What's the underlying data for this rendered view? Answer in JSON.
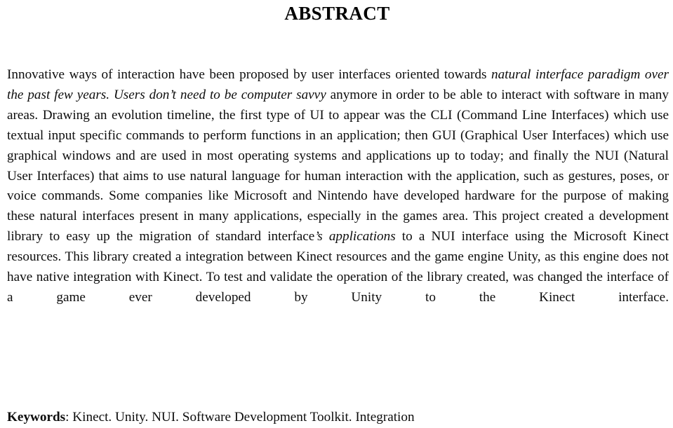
{
  "document": {
    "heading": "ABSTRACT",
    "abstract": {
      "segments": [
        {
          "style": "roman",
          "text": "Innovative ways of interaction have been proposed by user interfaces oriented towards "
        },
        {
          "style": "italic",
          "text": "natural interface paradigm over the past few years. Users don’t need to be computer savvy"
        },
        {
          "style": "roman",
          "text": " anymore in order to be able to interact with software in many areas. Drawing an evolution timeline, the first type of UI to appear was the CLI (Command Line Interfaces) which use textual input specific commands to perform functions in an application; then GUI (Graphical User Interfaces) which use graphical windows and are used in most operating systems and applications up to today; and finally the NUI (Natural User Interfaces) that aims to use natural language for human interaction with the application, such as gestures, poses, or voice commands. Some companies like Microsoft and Nintendo have developed hardware for the purpose of making these natural interfaces present in many applications, especially in the games area. This project created a development library to easy up the migration of standard interface"
        },
        {
          "style": "italic",
          "text": "’s applications"
        },
        {
          "style": "roman",
          "text": " to a NUI interface using the Microsoft Kinect resources. This library created a integration between Kinect resources and the game engine Unity, as this engine does not have native integration with Kinect. To test and validate the operation of the library created, was changed the interface of a game ever developed by Unity to the Kinect interface."
        }
      ]
    },
    "keywords": {
      "label": "Keywords",
      "separator": ": ",
      "terms_text": "Kinect. Unity. NUI. Software Development Toolkit. Integration",
      "terms": [
        "Kinect",
        "Unity",
        "NUI",
        "Software Development Toolkit",
        "Integration"
      ]
    },
    "colors": {
      "background": "#ffffff",
      "text": "#0d0d0d",
      "heading": "#000000"
    }
  }
}
